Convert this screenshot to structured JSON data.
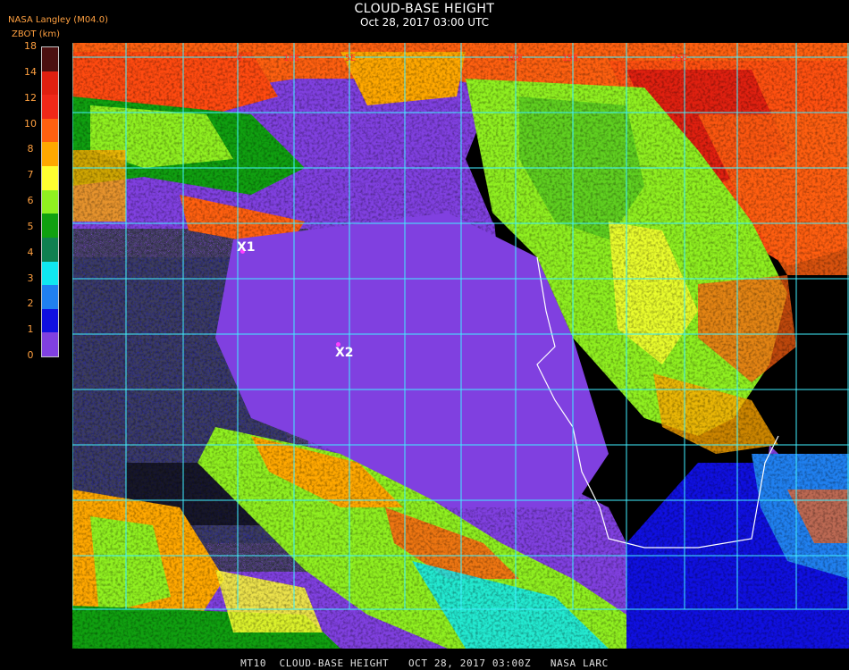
{
  "title": "CLOUD-BASE HEIGHT",
  "subtitle": "Oct 28, 2017 03:00 UTC",
  "product": "NASA Langley (M04.0)",
  "units": "ZBOT (km)",
  "footer": "MT10  CLOUD-BASE HEIGHT   OCT 28, 2017 03:00Z   NASA LARC",
  "legend": {
    "ticks": [
      "18",
      "14",
      "12",
      "10",
      "8",
      "7",
      "6",
      "5",
      "4",
      "3",
      "2",
      "1",
      "0"
    ],
    "colors": [
      "#4a1010",
      "#e02010",
      "#f02818",
      "#ff6010",
      "#ffa800",
      "#ffff30",
      "#90f020",
      "#10a010",
      "#108050",
      "#10e8f0",
      "#2080f0",
      "#1010e0",
      "#8040e0"
    ]
  },
  "map": {
    "lon_labels": [
      "0",
      "10E",
      "5E",
      "10E",
      "15E",
      "25E"
    ],
    "markers": [
      {
        "label": "X1",
        "color": "#ff40ff"
      },
      {
        "label": "X2",
        "color": "#ff40ff"
      }
    ],
    "grid_color": "#40f0ff",
    "coast_color": "#ffffff"
  }
}
